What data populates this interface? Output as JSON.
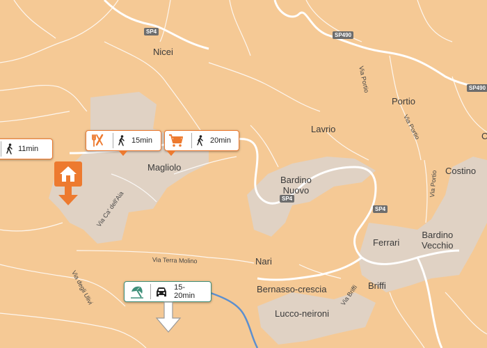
{
  "places": {
    "nicei": "Nicei",
    "portio": "Portio",
    "lavrio": "Lavrio",
    "magliolo": "Magliolo",
    "bardino_nuovo": "Bardino\nNuovo",
    "costino": "Costino",
    "ferrari": "Ferrari",
    "bardino_vecchio": "Bardino\nVecchio",
    "nari": "Nari",
    "briffi": "Briffi",
    "bernasso": "Bernasso-crescia",
    "lucco": "Lucco-neironi",
    "edge_c": "C"
  },
  "streets": {
    "via_portio_1": "Via Portio",
    "via_portio_2": "Via Portio",
    "via_portio_3": "Via Portio",
    "via_ca": "Via Ca' dell'Aia",
    "via_terra": "Via Terra Molino",
    "via_ulivi": "Via degli Ulivi",
    "via_briffi": "Via Briffi"
  },
  "road_shields": {
    "sp4_top": "SP4",
    "sp490_a": "SP490",
    "sp490_b": "SP490",
    "sp4_mid": "SP4",
    "sp4_right": "SP4"
  },
  "callouts": {
    "walk_left": {
      "icon": "walking-person-icon",
      "time": "11min"
    },
    "restaurant": {
      "icon": "fork-knife-icon",
      "walk_icon": "walking-person-icon",
      "time": "15min"
    },
    "shop": {
      "icon": "shopping-cart-icon",
      "walk_icon": "walking-person-icon",
      "time": "20min"
    },
    "beach": {
      "icon": "beach-umbrella-icon",
      "car_icon": "car-icon",
      "time": "15-20min"
    }
  },
  "colors": {
    "background": "#f5c995",
    "settlement": "#e0d2c4",
    "road": "#ffffff",
    "accent": "#ed7a2f",
    "beach_accent": "#3f8f7a",
    "river": "#5c8fcf",
    "shield": "#6d6d6d"
  },
  "markers": {
    "home": "house-marker-icon",
    "direction": "down-arrow-icon"
  }
}
